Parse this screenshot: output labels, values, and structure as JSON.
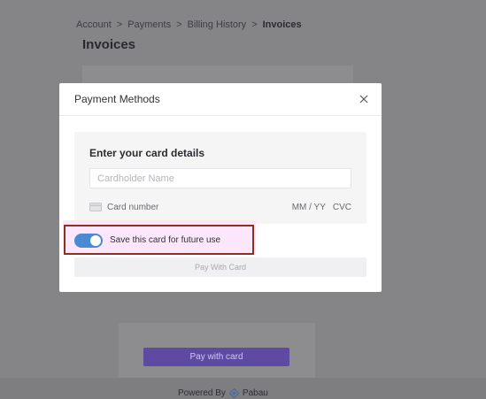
{
  "breadcrumb": {
    "items": [
      "Account",
      "Payments",
      "Billing History",
      "Invoices"
    ],
    "separator": ">"
  },
  "page": {
    "title": "Invoices",
    "pay_button_label": "Pay with card"
  },
  "footer": {
    "powered_by": "Powered By",
    "brand": "Pabau"
  },
  "modal": {
    "title": "Payment Methods",
    "card_section": {
      "heading": "Enter your card details",
      "cardholder_placeholder": "Cardholder Name",
      "card_number_placeholder": "Card number",
      "expiry_placeholder": "MM / YY",
      "cvc_placeholder": "CVC"
    },
    "save_card": {
      "label": "Save this card for future use",
      "enabled": true
    },
    "pay_button_label": "Pay With Card"
  },
  "colors": {
    "overlay": "#858487",
    "accent_purple": "#5f4aa3",
    "toggle_blue": "#4a8ad3",
    "highlight_border": "#8b3121"
  },
  "icons": [
    "close-icon",
    "credit-card-icon",
    "pabau-logo-icon"
  ]
}
